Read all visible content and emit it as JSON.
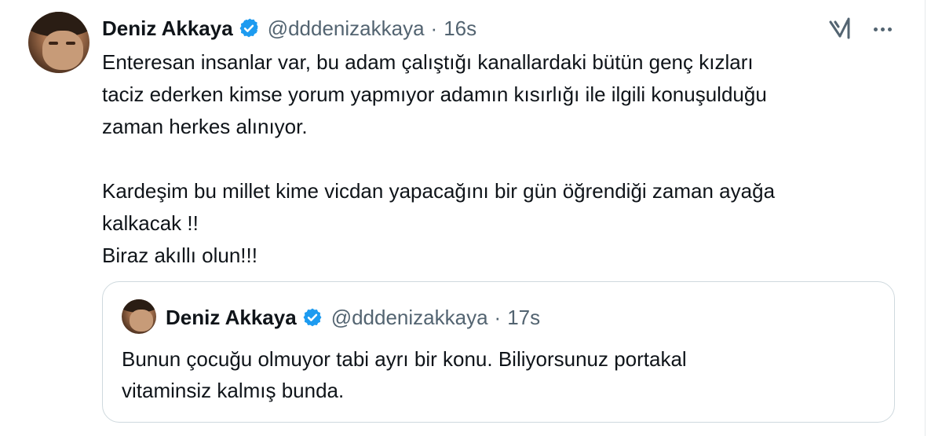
{
  "tweet": {
    "author_name": "Deniz Akkaya",
    "handle": "@dddenizakkaya",
    "separator": "·",
    "time": "16s",
    "lines": [
      "Enteresan insanlar var, bu adam çalıştığı kanallardaki bütün genç kızları",
      "taciz ederken kimse yorum yapmıyor adamın kısırlığı ile ilgili konuşulduğu",
      "zaman herkes alınıyor.",
      "",
      "Kardeşim bu millet kime vicdan yapacağını bir gün öğrendiği zaman ayağa",
      "kalkacak !!",
      "Biraz akıllı olun!!!"
    ]
  },
  "quoted": {
    "author_name": "Deniz Akkaya",
    "handle": "@dddenizakkaya",
    "separator": "·",
    "time": "17s",
    "lines": [
      "Bunun çocuğu olmuyor tabi ayrı bir konu. Biliyorsunuz portakal",
      "vitaminsiz kalmış bunda."
    ]
  },
  "icons": {
    "verified": "verified-badge-icon",
    "grok": "grok-icon",
    "more": "more-options-icon"
  },
  "colors": {
    "verified_blue": "#1d9bf0",
    "secondary_text": "#536471",
    "border": "#cfd9de"
  }
}
